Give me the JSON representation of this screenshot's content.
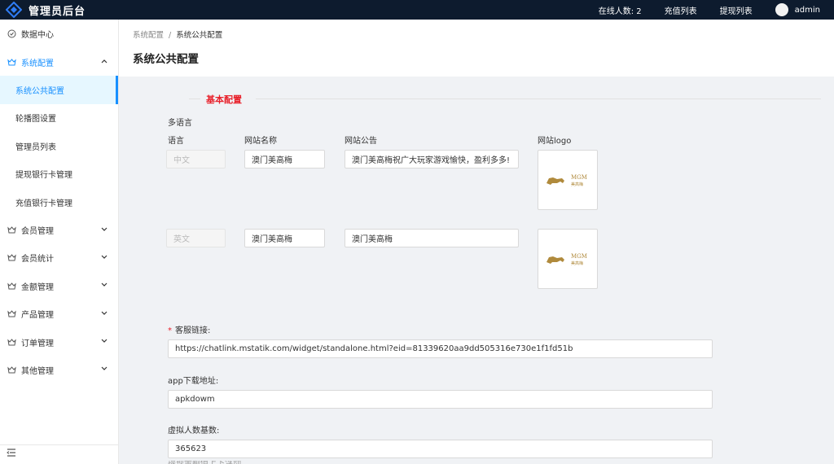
{
  "header": {
    "app_title": "管理员后台",
    "online_label": "在线人数: 2",
    "recharge_list": "充值列表",
    "withdraw_list": "提现列表",
    "username": "admin"
  },
  "sidebar": {
    "items": [
      {
        "label": "数据中心",
        "icon": "dashboard-icon"
      },
      {
        "label": "系统配置",
        "icon": "gear-icon",
        "open": true,
        "children": [
          "系统公共配置",
          "轮播图设置",
          "管理员列表",
          "提现银行卡管理",
          "充值银行卡管理"
        ]
      },
      {
        "label": "会员管理",
        "icon": "crown-icon"
      },
      {
        "label": "会员统计",
        "icon": "crown-icon"
      },
      {
        "label": "金额管理",
        "icon": "crown-icon"
      },
      {
        "label": "产品管理",
        "icon": "crown-icon"
      },
      {
        "label": "订单管理",
        "icon": "crown-icon"
      },
      {
        "label": "其他管理",
        "icon": "crown-icon"
      }
    ],
    "active_child": "系统公共配置"
  },
  "breadcrumb": [
    "系统配置",
    "系统公共配置"
  ],
  "page_title": "系统公共配置",
  "form": {
    "section_title": "基本配置",
    "multilang_label": "多语言",
    "col_language": "语言",
    "col_site_name": "网站名称",
    "col_notice": "网站公告",
    "col_logo": "网站logo",
    "rows": [
      {
        "language": "中文",
        "site_name": "澳门美高梅",
        "notice": "澳门美高梅祝广大玩家游戏愉快，盈利多多!",
        "logo_text": "MGM",
        "logo_cn": "美高梅"
      },
      {
        "language": "英文",
        "site_name": "澳门美高梅",
        "notice": "澳门美高梅",
        "logo_text": "MGM",
        "logo_cn": "美高梅"
      }
    ],
    "service_link_label": "客服链接:",
    "service_link_value": "https://chatlink.mstatik.com/widget/standalone.html?eid=81339620aa9dd505316e730e1f1fd51b",
    "app_download_label": "app下载地址:",
    "app_download_value": "apkdowm",
    "virtual_base_label": "虚拟人数基数:",
    "virtual_base_value": "365623",
    "cut_hint": "提现金额值上下浮动"
  },
  "colors": {
    "topbar": "#0d1b2e",
    "accent": "#1890ff",
    "section": "#e8202a"
  }
}
